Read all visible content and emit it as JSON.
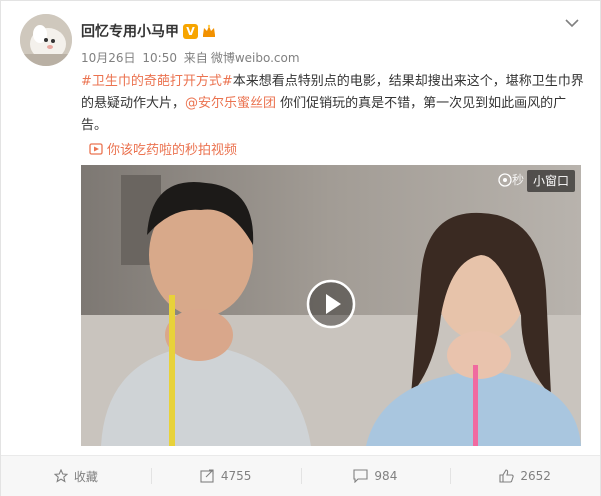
{
  "post": {
    "user_name": "回忆专用小马甲",
    "verified_badge": "V",
    "date": "10月26日",
    "time": "10:50",
    "source_prefix": "来自",
    "source": "微博weibo.com",
    "text": {
      "hashtag": "#卫生巾的奇葩打开方式#",
      "body1": "本来想看点特别点的电影，结果却搜出来这个，堪称卫生巾界的悬疑动作大片，",
      "mention": "@安尔乐蜜丝团",
      "body2": " 你们促销玩的真是不错，第一次见到如此画风的广告。"
    },
    "video_link": "你该吃药啦的秒拍视频"
  },
  "video": {
    "watermark": "秒",
    "mini_window_label": "小窗口"
  },
  "actions": {
    "favorite_label": "收藏",
    "repost_count": "4755",
    "comment_count": "984",
    "like_count": "2652"
  },
  "colors": {
    "link": "#eb7350",
    "text": "#333333",
    "meta": "#808080",
    "verified": "#f7a500"
  },
  "icons": [
    "avatar",
    "chevron-down-icon",
    "verified-badge-icon",
    "vip-crown-icon",
    "video-link-icon",
    "play-icon",
    "star-icon",
    "repost-icon",
    "comment-icon",
    "like-icon"
  ]
}
